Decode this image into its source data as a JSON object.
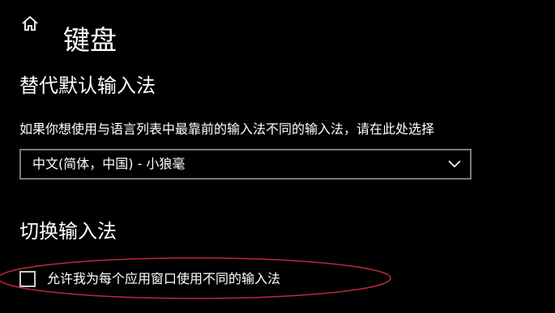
{
  "header": {
    "home_icon": "home-icon",
    "title": "键盘"
  },
  "override_section": {
    "title": "替代默认输入法",
    "description": "如果你想使用与语言列表中最靠前的输入法不同的输入法，请在此处选择",
    "dropdown": {
      "selected": "中文(简体，中国) - 小狼毫",
      "icon": "chevron-down-icon"
    }
  },
  "switch_section": {
    "title": "切换输入法",
    "checkbox": {
      "label": "允许我为每个应用窗口使用不同的输入法",
      "checked": false
    }
  },
  "colors": {
    "background": "#000000",
    "text": "#ffffff",
    "dropdown_border": "#7a7a7a",
    "annotation": "#c0283c"
  }
}
